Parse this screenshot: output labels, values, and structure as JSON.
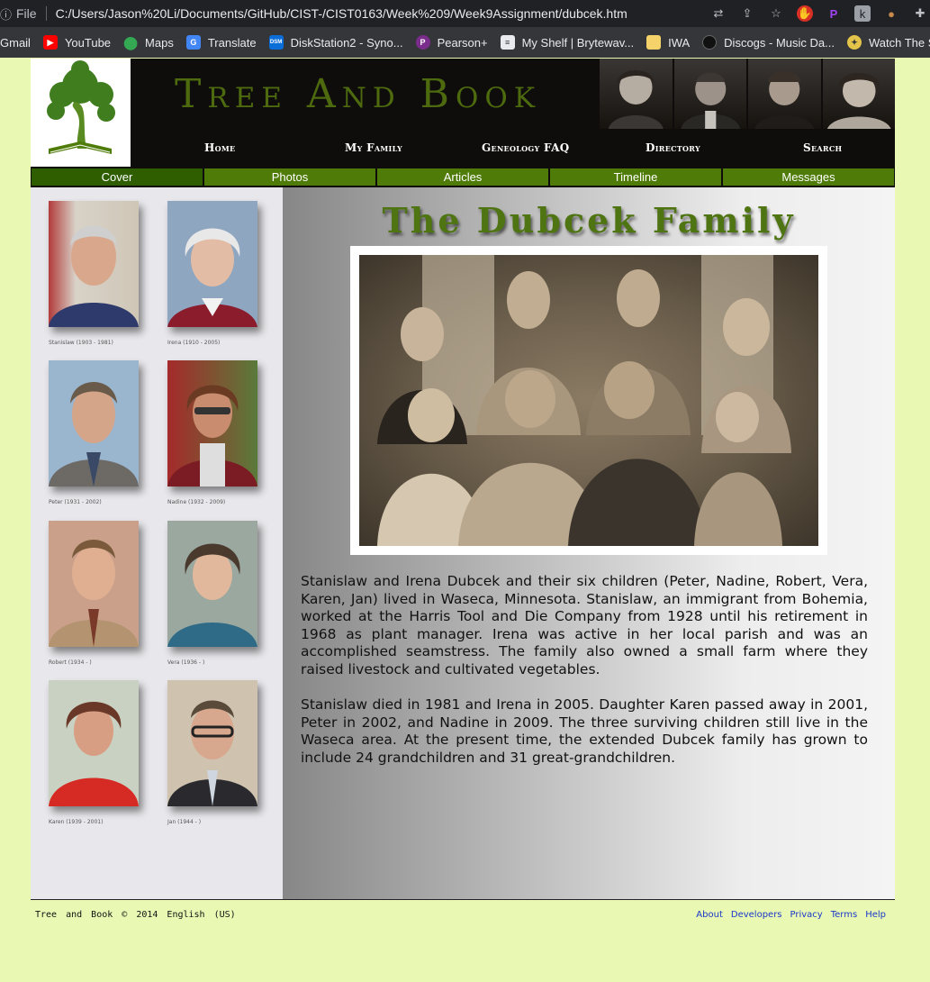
{
  "browser": {
    "file_label": "File",
    "url": "C:/Users/Jason%20Li/Documents/GitHub/CIST-/CIST0163/Week%209/Week9Assignment/dubcek.htm",
    "bookmarks": [
      {
        "label": "Gmail",
        "icon": "gmail-icon",
        "color": "#ea4335"
      },
      {
        "label": "YouTube",
        "icon": "youtube-icon",
        "color": "#ff0000"
      },
      {
        "label": "Maps",
        "icon": "maps-icon",
        "color": "#34a853"
      },
      {
        "label": "Translate",
        "icon": "translate-icon",
        "color": "#4285f4"
      },
      {
        "label": "DiskStation2 - Syno...",
        "icon": "dsm-icon",
        "color": "#0a6dd8"
      },
      {
        "label": "Pearson+",
        "icon": "pearson-icon",
        "color": "#7b2d8b"
      },
      {
        "label": "My Shelf | Brytewav...",
        "icon": "shelf-icon",
        "color": "#9aa0a6"
      },
      {
        "label": "IWA",
        "icon": "folder-icon",
        "color": "#f6d26b"
      },
      {
        "label": "Discogs - Music Da...",
        "icon": "discogs-icon",
        "color": "#333333"
      },
      {
        "label": "Watch The Secret...",
        "icon": "watch-icon",
        "color": "#e3c44a"
      }
    ]
  },
  "site": {
    "title": "Tree And Book",
    "nav": [
      "Home",
      "My Family",
      "Geneology FAQ",
      "Directory",
      "Search"
    ],
    "tabs": [
      "Cover",
      "Photos",
      "Articles",
      "Timeline",
      "Messages"
    ],
    "active_tab": "Cover"
  },
  "people": [
    {
      "caption": "Stanislaw (1903 - 1981)"
    },
    {
      "caption": "Irena (1910 - 2005)"
    },
    {
      "caption": "Peter (1931 - 2002)"
    },
    {
      "caption": "Nadine (1932 - 2009)"
    },
    {
      "caption": "Robert (1934 - )"
    },
    {
      "caption": "Vera (1936 - )"
    },
    {
      "caption": "Karen (1939 - 2001)"
    },
    {
      "caption": "Jan (1944 - )"
    }
  ],
  "main": {
    "heading": "The Dubcek Family",
    "paragraph1": "Stanislaw and Irena Dubcek and their six children (Peter, Nadine, Robert, Vera, Karen, Jan) lived in Waseca, Minnesota. Stanislaw, an immigrant from Bohemia, worked at the Harris Tool and Die Company from 1928 until his retirement in 1968 as plant manager. Irena was active in her local parish and was an accomplished seamstress. The family also owned a small farm where they raised livestock and cultivated vegetables.",
    "paragraph2": "Stanislaw died in 1981 and Irena in 2005. Daughter Karen passed away in 2001, Peter in 2002, and Nadine in 2009. The three surviving children still live in the Waseca area. At the present time, the extended Dubcek family has grown to include 24 grandchildren and 31 great-grandchildren."
  },
  "footer": {
    "left": "Tree and Book © 2014 English (US)",
    "links": [
      "About",
      "Developers",
      "Privacy",
      "Terms",
      "Help"
    ]
  }
}
